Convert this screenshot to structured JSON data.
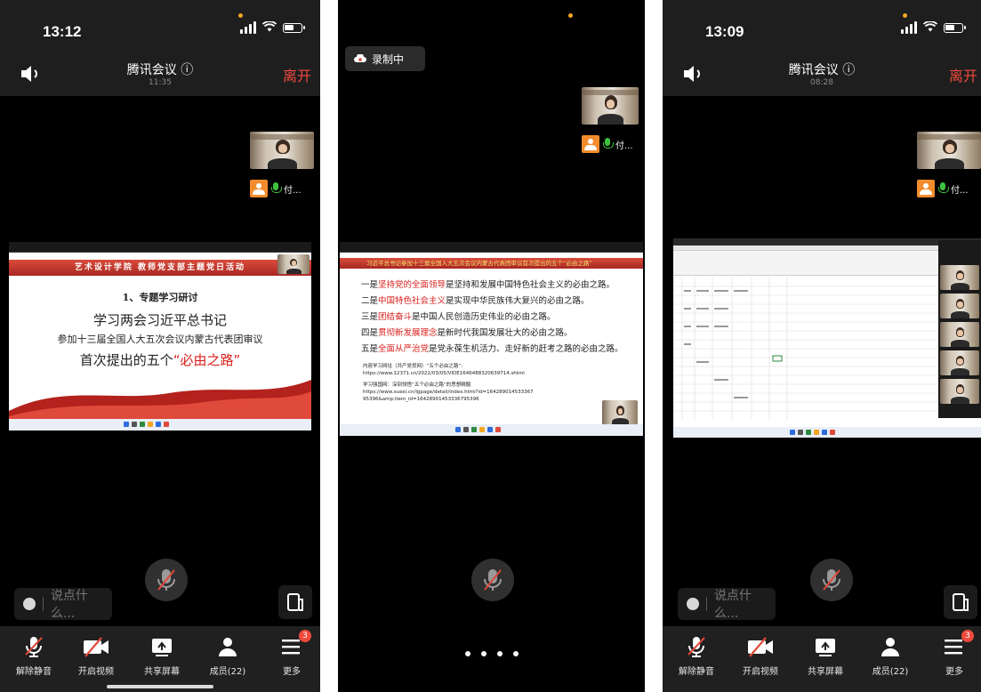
{
  "left_phone": {
    "status_time": "13:12",
    "meeting_title": "腾讯会议 ⓘ",
    "meeting_elapsed": "11:35",
    "leave_label": "离开",
    "participant_name": "付...",
    "slide": {
      "header": "艺术设计学院 教师党支部主题党日活动",
      "line1": "1、专题学习研讨",
      "line2": "学习两会习近平总书记",
      "line3": "参加十三届全国人大五次会议内蒙古代表团审议",
      "line4_a": "首次提出的五个",
      "line4_b": "“必由之路”"
    },
    "chat_placeholder": "说点什么..."
  },
  "middle_phone": {
    "recording_label": "录制中",
    "participant_name": "付...",
    "slide": {
      "banner": "习近平总书记参加十三届全国人大五次会议内蒙古代表团审议首次提出的五个“必由之路”",
      "points": [
        {
          "a": "一是",
          "b": "坚持党的全面领导",
          "c": "是坚持和发展中国特色社会主义的必由之路。"
        },
        {
          "a": "二是",
          "b": "中国特色社会主义",
          "c": "是实现中华民族伟大复兴的必由之路。"
        },
        {
          "a": "三是",
          "b": "团结奋斗",
          "c": "是中国人民创造历史伟业的必由之路。"
        },
        {
          "a": "四是",
          "b": "贯彻新发展理念",
          "c": "是新时代我国发展壮大的必由之路。"
        },
        {
          "a": "五是",
          "b": "全面从严治党",
          "c": "是党永葆生机活力、走好新的赶考之路的必由之路。"
        }
      ],
      "ref1": "内容学习网址（共产党员网）“五个必由之路”:",
      "ref1_url": "https://www.12371.cn/2022/03/05/VIDE1646488320639714.shtml",
      "ref2": "学习强国网：深刻领悟“五个必由之路”的思想精髓",
      "ref2_url": "https://www.xuexi.cn/lgpage/detail/index.html?id=164289014533367",
      "ref2_url_b": "95396&amp;item_id=16428901453336795396"
    }
  },
  "right_phone": {
    "status_time": "13:09",
    "meeting_title": "腾讯会议 ⓘ",
    "meeting_elapsed": "08:28",
    "leave_label": "离开",
    "participant_name": "付...",
    "chat_placeholder": "说点什么..."
  },
  "toolbar": {
    "unmute": "解除静音",
    "start_video": "开启视频",
    "share_screen": "共享屏幕",
    "members": "成员(22)",
    "more": "更多",
    "more_badge": "3"
  },
  "colors": {
    "leave_red": "#f04a3c",
    "avatar_orange": "#f38c2c",
    "mic_green": "#3ec23e",
    "slide_red": "#d8201c"
  }
}
